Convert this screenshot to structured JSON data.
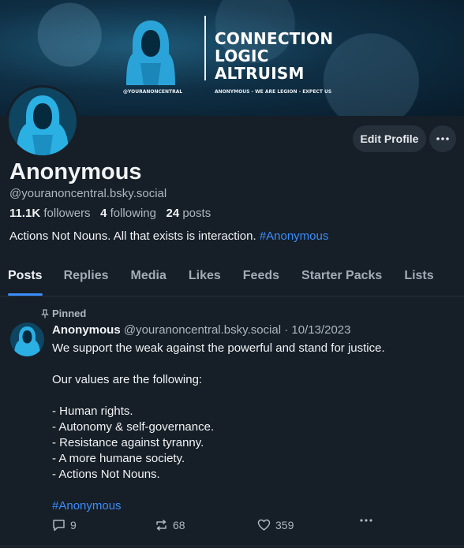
{
  "banner": {
    "lines": [
      "CONNECTION",
      "LOGIC",
      "ALTRUISM"
    ],
    "handle_small": "@YOURANONCENTRAL",
    "tagline_small": "ANONYMOUS - WE ARE LEGION - EXPECT US"
  },
  "profile": {
    "edit_label": "Edit Profile",
    "name": "Anonymous",
    "handle": "@youranoncentral.bsky.social",
    "followers_count": "11.1K",
    "followers_label": "followers",
    "following_count": "4",
    "following_label": "following",
    "posts_count": "24",
    "posts_label": "posts",
    "bio_text": "Actions Not Nouns. All that exists is interaction. ",
    "bio_hashtag": "#Anonymous"
  },
  "tabs": [
    "Posts",
    "Replies",
    "Media",
    "Likes",
    "Feeds",
    "Starter Packs",
    "Lists"
  ],
  "post": {
    "pinned_label": "Pinned",
    "author": "Anonymous",
    "handle": "@youranoncentral.bsky.social",
    "separator": "·",
    "date": "10/13/2023",
    "lines": [
      "We support the weak against the powerful and stand for justice.",
      "",
      "Our values are the following:",
      "",
      "- Human rights.",
      "- Autonomy & self-governance.",
      "- Resistance against tyranny.",
      "- A more humane society.",
      "- Actions Not Nouns.",
      ""
    ],
    "hashtag": "#Anonymous",
    "replies": "9",
    "reposts": "68",
    "likes": "359"
  },
  "colors": {
    "accent": "#3b8dfa",
    "background": "#161e27",
    "muted": "#aeb6bf"
  },
  "icons": [
    "pin-icon",
    "reply-icon",
    "repost-icon",
    "heart-icon",
    "more-dots-icon"
  ]
}
